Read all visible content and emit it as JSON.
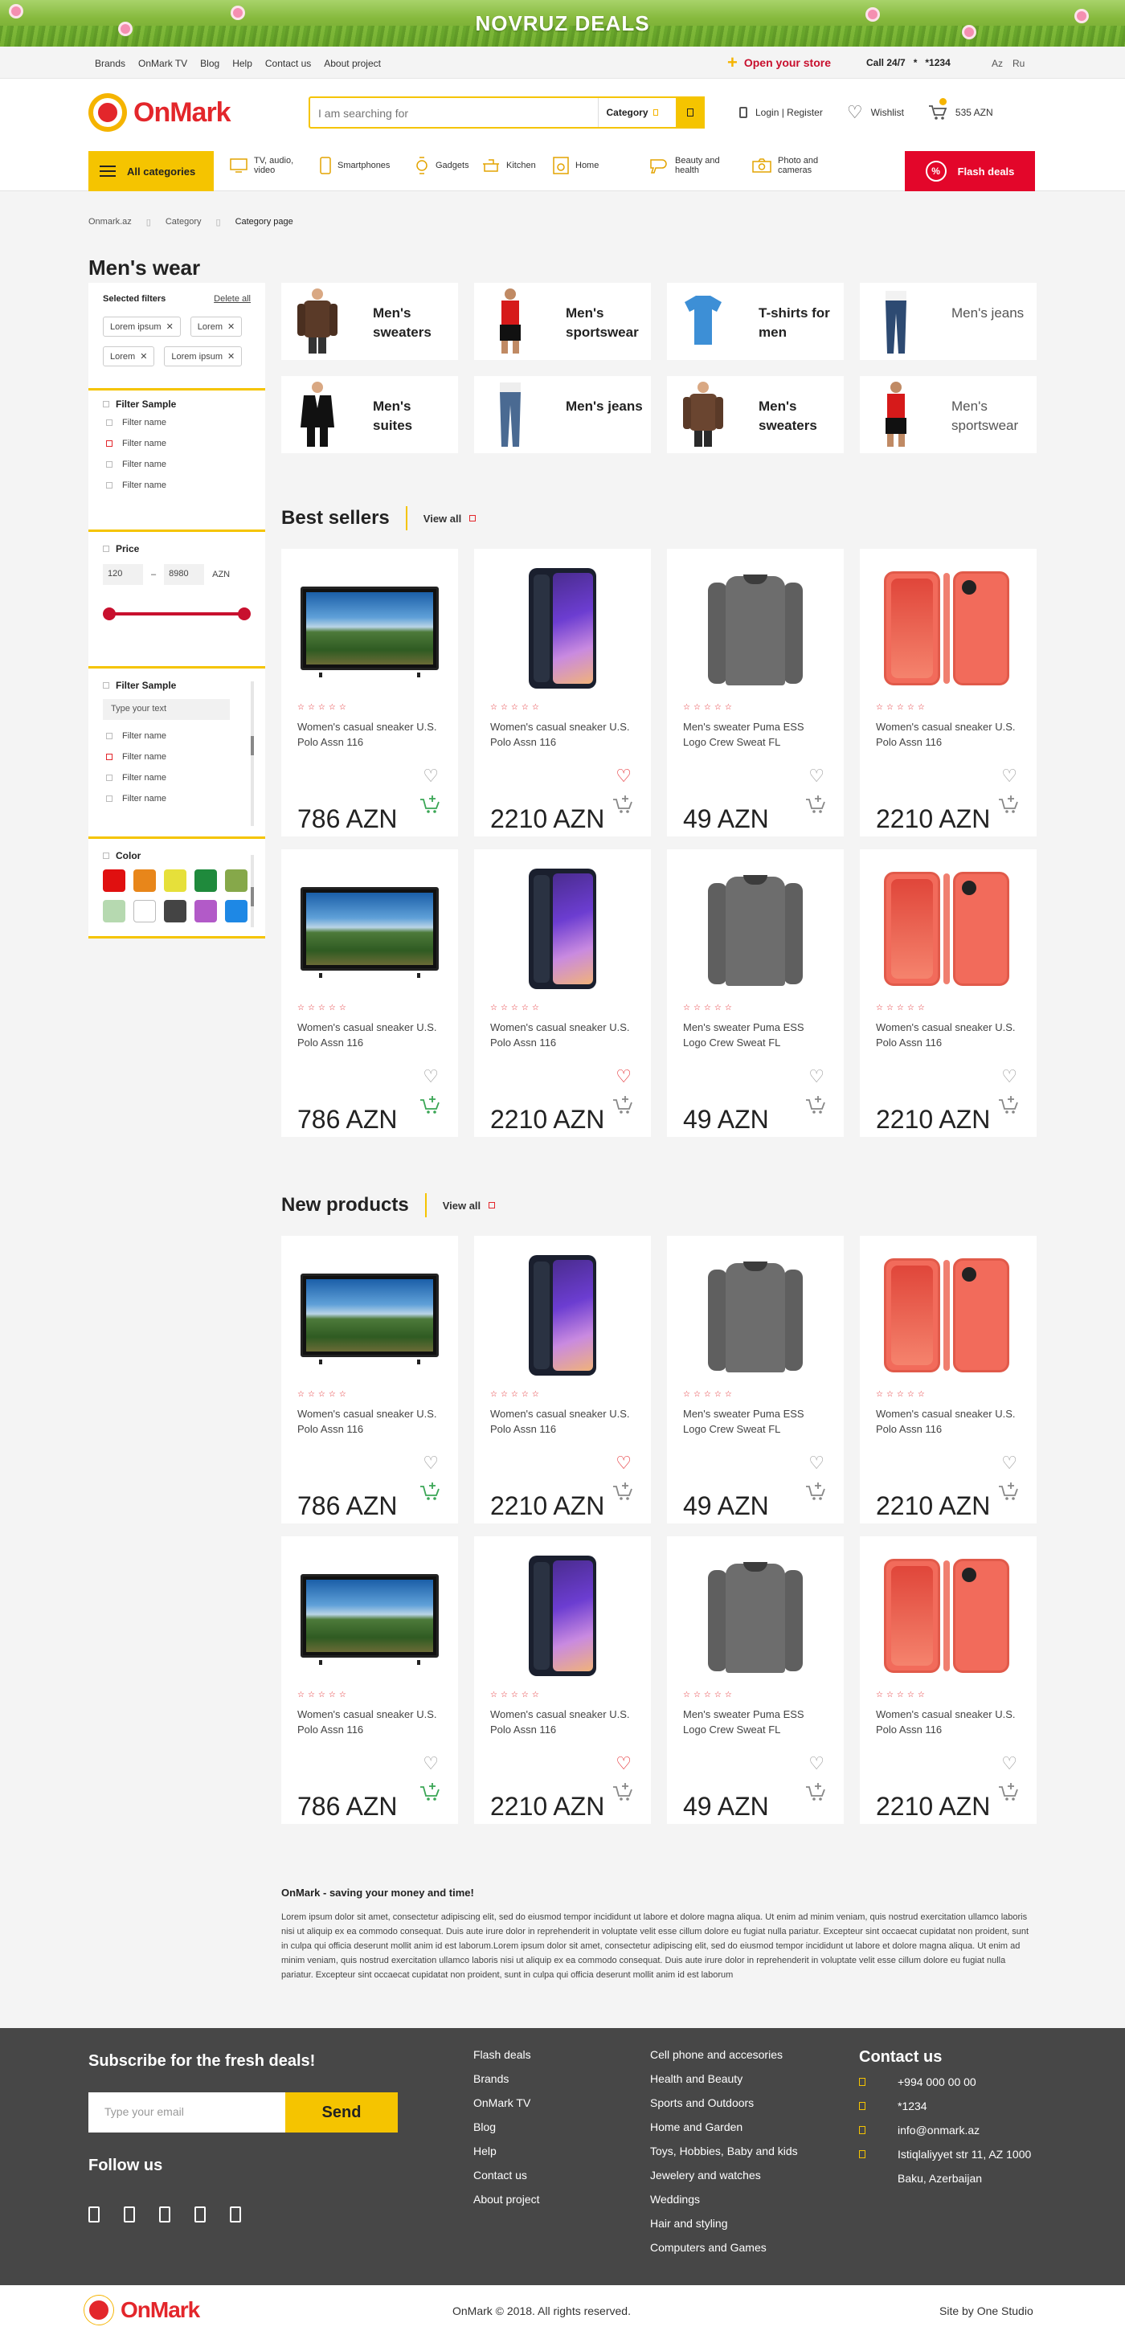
{
  "banner": {
    "title": "NOVRUZ DEALS"
  },
  "topbar": {
    "links": [
      "Brands",
      "OnMark TV",
      "Blog",
      "Help",
      "Contact us",
      "About project"
    ],
    "store": "Open your store",
    "call_label": "Call 24/7",
    "call_number": "*1234",
    "langs": [
      "Az",
      "Ru"
    ]
  },
  "header": {
    "logo": "OnMark",
    "search_placeholder": "I am searching for",
    "category_label": "Category",
    "login": "Login | Register",
    "wishlist": "Wishlist",
    "cart_total": "535 AZN"
  },
  "catbar": {
    "all": "All categories",
    "items": [
      {
        "label": "TV, audio, video",
        "icon": "tv-icon"
      },
      {
        "label": "Smartphones",
        "icon": "smartphone-icon"
      },
      {
        "label": "Gadgets",
        "icon": "gadget-icon"
      },
      {
        "label": "Kitchen",
        "icon": "kitchen-icon"
      },
      {
        "label": "Home",
        "icon": "home-icon"
      },
      {
        "label": "Beauty and health",
        "icon": "hairdryer-icon"
      },
      {
        "label": "Photo and cameras",
        "icon": "camera-icon"
      }
    ],
    "flash": "Flash deals"
  },
  "breadcrumbs": [
    "Onmark.az",
    "Category",
    "Category page"
  ],
  "page_title": "Men's wear",
  "filters": {
    "selected_title": "Selected filters",
    "delete_all": "Delete all",
    "tags": [
      "Lorem ipsum",
      "Lorem",
      "Lorem",
      "Lorem ipsum"
    ],
    "sample1_title": "Filter Sample",
    "sample1_items": [
      "Filter name",
      "Filter name",
      "Filter name",
      "Filter name"
    ],
    "price_title": "Price",
    "price_min": "120",
    "price_max": "8980",
    "currency": "AZN",
    "sample2_title": "Filter Sample",
    "sample2_placeholder": "Type your text",
    "sample2_items": [
      "Filter name",
      "Filter name",
      "Filter name",
      "Filter name"
    ],
    "color_title": "Color",
    "colors": [
      "#e01010",
      "#e8861a",
      "#e6e03a",
      "#1f8a3c",
      "#86a84a",
      "#b6d9b0",
      "#ffffff",
      "#444444",
      "#b25ac8",
      "#1e88e5"
    ]
  },
  "category_cards": [
    {
      "label": "Men's sweaters",
      "light": false
    },
    {
      "label": "Men's sportswear",
      "light": false
    },
    {
      "label": "T-shirts for men",
      "light": false
    },
    {
      "label": "Men's jeans",
      "light": true
    },
    {
      "label": "Men's suites",
      "light": false
    },
    {
      "label": "Men's jeans",
      "light": false
    },
    {
      "label": "Men's sweaters",
      "light": false
    },
    {
      "label": "Men's sportswear",
      "light": true
    }
  ],
  "best_sellers": {
    "title": "Best sellers",
    "view_all": "View all"
  },
  "new_products": {
    "title": "New products",
    "view_all": "View all"
  },
  "products": [
    {
      "name": "Women's casual sneaker U.S. Polo Assn 116",
      "price": "786 AZN",
      "kind": "tv",
      "liked": false,
      "cart_green": true
    },
    {
      "name": "Women's casual sneaker U.S. Polo Assn 116",
      "price": "2210 AZN",
      "kind": "phone",
      "liked": true,
      "cart_green": false
    },
    {
      "name": "Men's sweater Puma ESS Logo Crew Sweat FL",
      "price": "49 AZN",
      "kind": "sweater",
      "liked": false,
      "cart_green": false
    },
    {
      "name": "Women's casual sneaker U.S. Polo Assn 116",
      "price": "2210 AZN",
      "kind": "iphone",
      "liked": false,
      "cart_green": false
    }
  ],
  "about": {
    "title": "OnMark - saving your money and time!",
    "text": "Lorem ipsum dolor sit amet, consectetur adipiscing elit, sed do eiusmod tempor incididunt ut labore et dolore magna aliqua. Ut enim ad minim veniam, quis nostrud exercitation ullamco laboris nisi ut aliquip ex ea commodo consequat. Duis aute irure dolor in reprehenderit in voluptate velit esse cillum dolore eu fugiat nulla pariatur. Excepteur sint occaecat cupidatat non proident, sunt in culpa qui officia deserunt mollit anim id est laborum.Lorem ipsum dolor sit amet, consectetur adipiscing elit, sed do eiusmod tempor incididunt ut labore et dolore magna aliqua. Ut enim ad minim veniam, quis nostrud exercitation ullamco laboris nisi ut aliquip ex ea commodo consequat. Duis aute irure dolor in reprehenderit in voluptate velit esse cillum dolore eu fugiat nulla pariatur. Excepteur sint occaecat cupidatat non proident, sunt in culpa qui officia deserunt mollit anim id est laborum"
  },
  "footer": {
    "subscribe_title": "Subscribe for the fresh deals!",
    "email_placeholder": "Type your email",
    "send": "Send",
    "follow": "Follow us",
    "col1": [
      "Flash deals",
      "Brands",
      "OnMark TV",
      "Blog",
      "Help",
      "Contact us",
      "About project"
    ],
    "col2": [
      "Cell phone and accesories",
      "Health and Beauty",
      "Sports and Outdoors",
      "Home and Garden",
      "Toys, Hobbies, Baby and kids",
      "Jewelery and watches",
      "Weddings",
      "Hair and styling",
      "Computers and Games"
    ],
    "contact_title": "Contact us",
    "contacts": [
      "+994 000 00 00",
      "*1234",
      "info@onmark.az",
      "Istiqlaliyyet str 11, AZ 1000",
      "Baku, Azerbaijan"
    ]
  },
  "bottom": {
    "logo": "OnMark",
    "copyright": "OnMark © 2018. All rights reserved.",
    "site_by": "Site by One Studio"
  }
}
